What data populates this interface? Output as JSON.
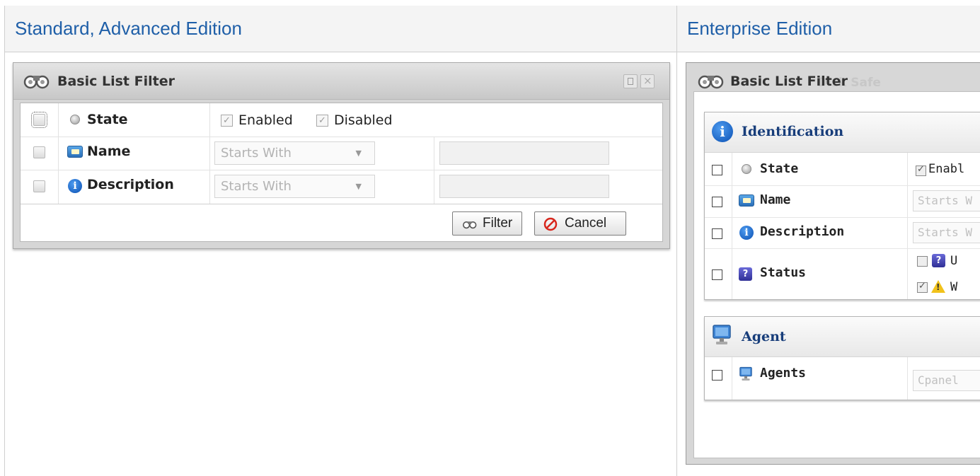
{
  "headers": {
    "left": "Standard, Advanced Edition",
    "right": "Enterprise Edition"
  },
  "left_panel": {
    "title": "Basic List Filter",
    "rows": {
      "state": {
        "label": "State",
        "enabled_label": "Enabled",
        "disabled_label": "Disabled"
      },
      "name": {
        "label": "Name",
        "operator": "Starts With",
        "value": ""
      },
      "description": {
        "label": "Description",
        "operator": "Starts With",
        "value": ""
      }
    },
    "buttons": {
      "filter": "Filter",
      "cancel": "Cancel"
    }
  },
  "right_panel": {
    "title": "Basic List Filter",
    "ghost_tab": "Disk Safe",
    "identification": {
      "title": "Identification",
      "state": {
        "label": "State",
        "value": "Enabl"
      },
      "name": {
        "label": "Name",
        "placeholder": "Starts W"
      },
      "description": {
        "label": "Description",
        "placeholder": "Starts W"
      },
      "status": {
        "label": "Status",
        "opt1": "U",
        "opt2": "W"
      }
    },
    "agent": {
      "title": "Agent",
      "agents": {
        "label": "Agents",
        "value": "Cpanel"
      }
    }
  },
  "colors": {
    "header_text": "#1f5fa8",
    "section_title": "#173d7a"
  }
}
